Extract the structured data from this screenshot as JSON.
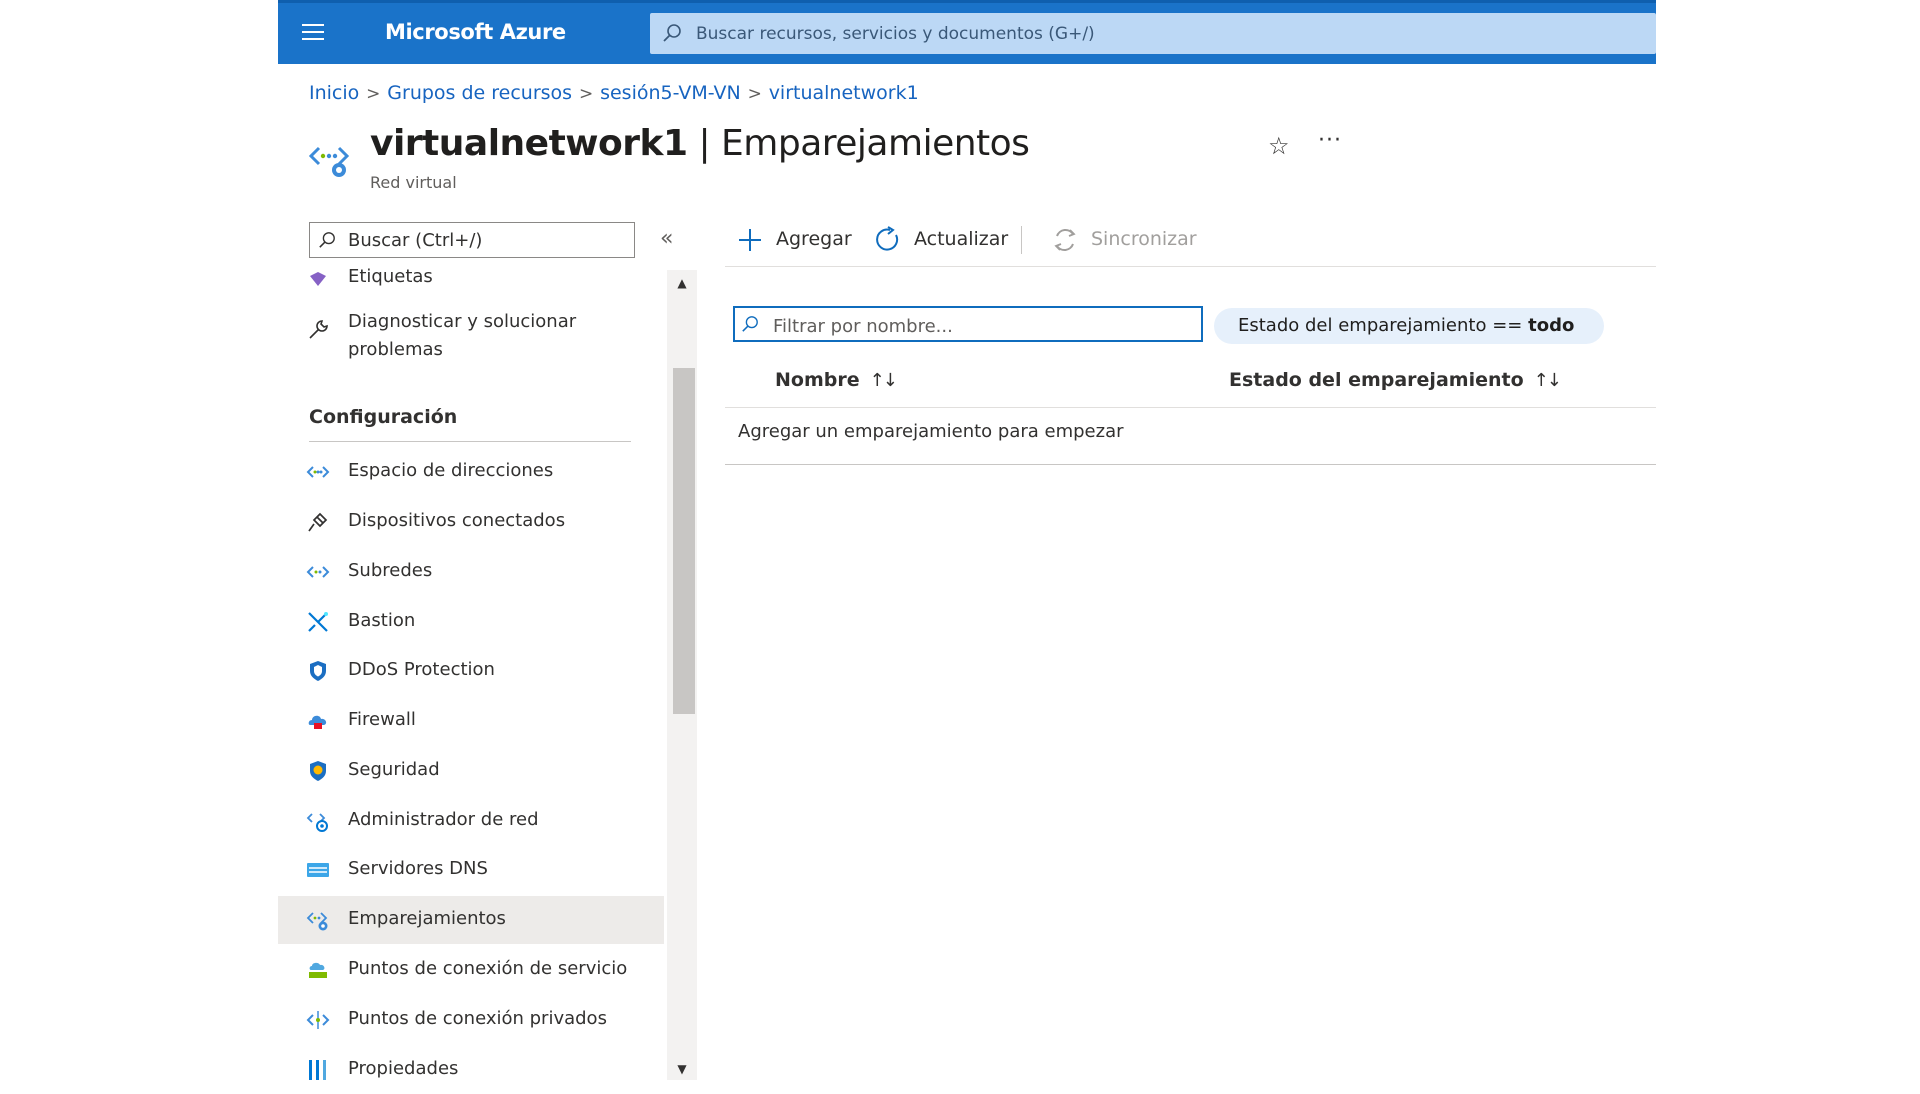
{
  "header": {
    "brand": "Microsoft Azure",
    "search_placeholder": "Buscar recursos, servicios y documentos (G+/)"
  },
  "breadcrumb": [
    "Inicio",
    "Grupos de recursos",
    "sesión5-VM-VN",
    "virtualnetwork1"
  ],
  "page": {
    "resource_name": "virtualnetwork1",
    "title_rest": " | Emparejamientos",
    "subtitle": "Red virtual",
    "favorite_icon": "☆",
    "more_icon": "···"
  },
  "sidebar": {
    "search_placeholder": "Buscar (Ctrl+/)",
    "collapse_icon": "«",
    "items_top": [
      {
        "label": "Etiquetas",
        "icon": "tag-icon"
      },
      {
        "label": "Diagnosticar y solucionar problemas",
        "icon": "wrench-icon"
      }
    ],
    "section": "Configuración",
    "items": [
      {
        "label": "Espacio de direcciones",
        "icon": "address-space-icon"
      },
      {
        "label": "Dispositivos conectados",
        "icon": "plug-icon"
      },
      {
        "label": "Subredes",
        "icon": "subnet-icon"
      },
      {
        "label": "Bastion",
        "icon": "bastion-icon"
      },
      {
        "label": "DDoS Protection",
        "icon": "shield-icon"
      },
      {
        "label": "Firewall",
        "icon": "firewall-icon"
      },
      {
        "label": "Seguridad",
        "icon": "security-shield-icon"
      },
      {
        "label": "Administrador de red",
        "icon": "network-manager-icon"
      },
      {
        "label": "Servidores DNS",
        "icon": "dns-icon"
      },
      {
        "label": "Emparejamientos",
        "icon": "peering-icon",
        "active": true
      },
      {
        "label": "Puntos de conexión de servicio",
        "icon": "service-endpoint-icon"
      },
      {
        "label": "Puntos de conexión privados",
        "icon": "private-endpoint-icon"
      },
      {
        "label": "Propiedades",
        "icon": "properties-icon"
      }
    ]
  },
  "toolbar": {
    "add": "Agregar",
    "refresh": "Actualizar",
    "sync": "Sincronizar"
  },
  "filter": {
    "placeholder": "Filtrar por nombre...",
    "pill_prefix": "Estado del emparejamiento == ",
    "pill_value": "todo"
  },
  "table": {
    "columns": [
      "Nombre",
      "Estado del emparejamiento"
    ],
    "sort_glyph": "↑↓",
    "empty_message": "Agregar un emparejamiento para empezar"
  },
  "colors": {
    "topbar": "#1a73c9",
    "link": "#1764c0",
    "accent": "#0f6cbd"
  }
}
